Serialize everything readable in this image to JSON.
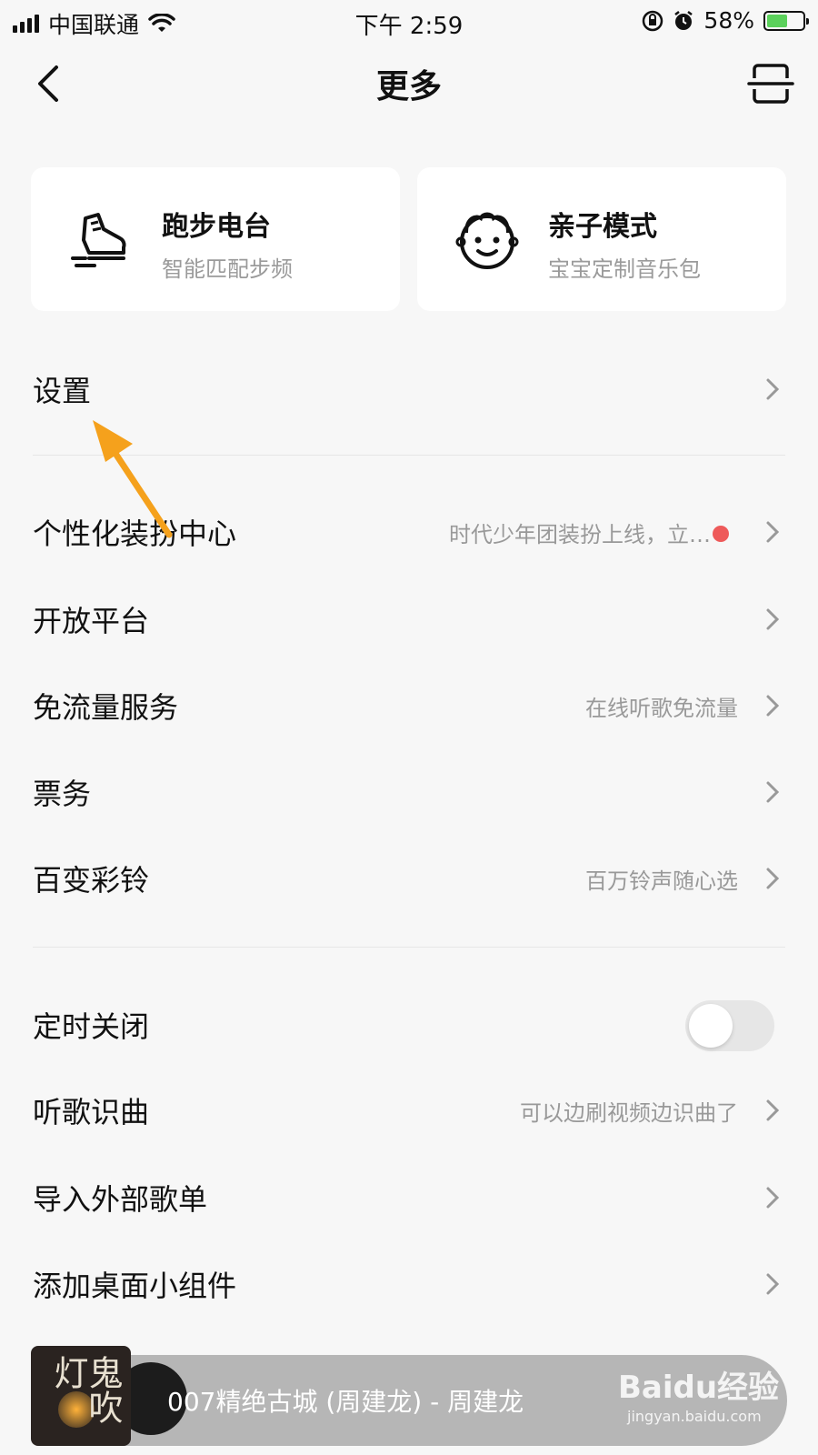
{
  "status_bar": {
    "carrier": "中国联通",
    "time": "下午 2:59",
    "battery_percent": "58%",
    "battery_level": 0.58
  },
  "header": {
    "title": "更多",
    "back_icon": "chevron-left-icon",
    "scan_icon": "scan-icon"
  },
  "cards": [
    {
      "title": "跑步电台",
      "subtitle": "智能匹配步频",
      "icon": "running-shoe-icon"
    },
    {
      "title": "亲子模式",
      "subtitle": "宝宝定制音乐包",
      "icon": "baby-face-icon"
    }
  ],
  "menu": {
    "settings": {
      "label": "设置"
    },
    "personalize": {
      "label": "个性化装扮中心",
      "hint": "时代少年团装扮上线，立…"
    },
    "open_platform": {
      "label": "开放平台"
    },
    "free_data": {
      "label": "免流量服务",
      "hint": "在线听歌免流量"
    },
    "tickets": {
      "label": "票务"
    },
    "ringtone": {
      "label": "百变彩铃",
      "hint": "百万铃声随心选"
    },
    "sleep_timer": {
      "label": "定时关闭",
      "enabled": false
    },
    "recognize": {
      "label": "听歌识曲",
      "hint": "可以边刷视频边识曲了"
    },
    "import_playlist": {
      "label": "导入外部歌单"
    },
    "add_widget": {
      "label": "添加桌面小组件"
    }
  },
  "player": {
    "now_playing": "007精绝古城 (周建龙) - 周建龙",
    "album_text": "鬼吹灯"
  },
  "watermark": {
    "main": "Baidu经验",
    "sub": "jingyan.baidu.com"
  },
  "colors": {
    "background": "#f7f7f7",
    "card": "#ffffff",
    "hint_text": "#999999",
    "red_dot": "#ee5a5a",
    "arrow": "#f5a11c"
  }
}
